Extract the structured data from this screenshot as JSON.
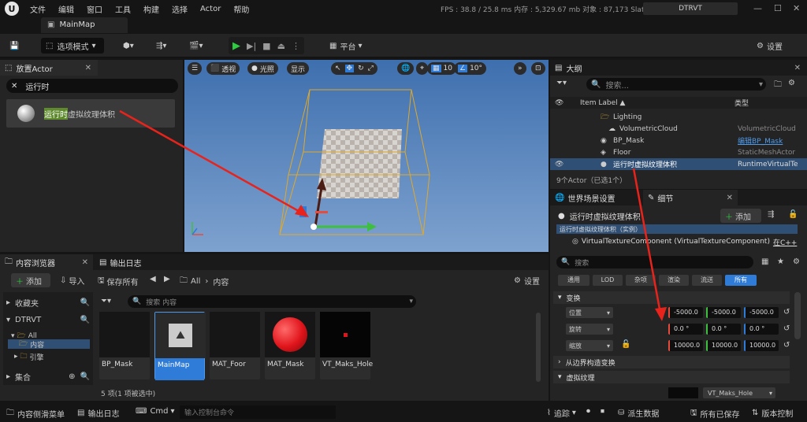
{
  "menubar": {
    "items": [
      "文件",
      "编辑",
      "窗口",
      "工具",
      "构建",
      "选择",
      "Actor",
      "帮助"
    ],
    "stats": "FPS :  38.8  / 25.8 ms  内存 :  5,329.67 mb  对象 :  87,173  Slate :  6",
    "project": "DTRVT"
  },
  "tabs": {
    "main": "MainMap"
  },
  "toolbar": {
    "mode": "选项模式",
    "platform": "平台",
    "settings": "设置"
  },
  "place_actor": {
    "title": "放置Actor",
    "search_value": "运行时",
    "item_highlight": "运行时",
    "item_rest": "虚拟纹理体积"
  },
  "viewport": {
    "perspective": "透视",
    "lit": "光照",
    "show": "显示",
    "grid_size": "10",
    "rot_snap": "10°"
  },
  "outliner": {
    "title": "大纲",
    "search_placeholder": "搜索...",
    "col_label": "Item Label ▲",
    "col_type": "类型",
    "rows": [
      {
        "label": "Lighting",
        "type": ""
      },
      {
        "label": "VolumetricCloud",
        "type": "VolumetricCloud"
      },
      {
        "label": "BP_Mask",
        "type": "编辑BP_Mask"
      },
      {
        "label": "Floor",
        "type": "StaticMeshActor"
      },
      {
        "label": "运行时虚拟纹理体积",
        "type": "RuntimeVirtualTe"
      }
    ],
    "count": "9个Actor（已选1个）"
  },
  "details": {
    "tab_world": "世界场景设置",
    "tab_details": "细节",
    "actor_name": "运行时虚拟纹理体积",
    "add_label": "添加",
    "instance_row": "运行时虚拟纹理体积（实例）",
    "component": "VirtualTextureComponent (VirtualTextureComponent)",
    "component_link": "在C++",
    "search_placeholder": "搜索",
    "filters": [
      "通用",
      "LOD",
      "杂项",
      "渲染",
      "流送",
      "所有"
    ],
    "transform_header": "变换",
    "location_label": "位置",
    "rotation_label": "旋转",
    "scale_label": "缩放",
    "location": [
      "-5000.0",
      "-5000.0",
      "-5000.0"
    ],
    "rotation": [
      "0.0 °",
      "0.0 °",
      "0.0 °"
    ],
    "scale": [
      "10000.0",
      "10000.0",
      "10000.0"
    ],
    "from_bounds": "从边界构造变换",
    "vt_header": "虚拟纹理",
    "vt_value": "VT_Maks_Hole"
  },
  "content_browser": {
    "tab_cb": "内容浏览器",
    "tab_log": "输出日志",
    "add": "添加",
    "import": "导入",
    "save_all": "保存所有",
    "path_all": "All",
    "path_content": "内容",
    "settings": "设置",
    "favorites": "收藏夹",
    "project": "DTRVT",
    "tree_all": "All",
    "tree_content": "内容",
    "tree_engine": "引擎",
    "collections": "集合",
    "search_placeholder": "搜索 内容",
    "assets": [
      "BP_Mask",
      "MainMap",
      "MAT_Foor",
      "MAT_Mask",
      "VT_Maks_Hole"
    ],
    "footer": "5 项(1 项被选中)"
  },
  "statusbar": {
    "drawer": "内容侧滑菜单",
    "log": "输出日志",
    "cmd": "Cmd",
    "console_placeholder": "输入控制台命令",
    "trace": "追踪",
    "derived": "派生数据",
    "all_saved": "所有已保存",
    "source_control": "版本控制"
  },
  "colors": {
    "play": "#2ecc40",
    "selection": "#2f7bd8",
    "highlight": "#5f8a2e",
    "annotation": "#e8231b"
  }
}
